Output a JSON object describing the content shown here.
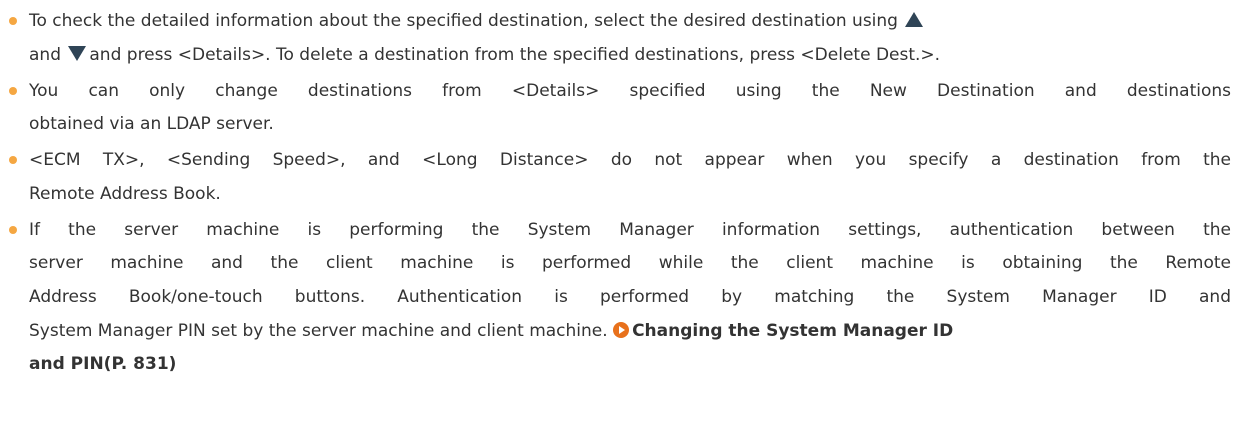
{
  "colors": {
    "text": "#333333",
    "bullet": "#f5a742",
    "arrow_icon": "#2f4456",
    "link_icon": "#e8711c"
  },
  "notes": [
    {
      "lines": [
        [
          "To check the detailed information about the specified destination, select the desired destination using"
        ],
        [
          "and",
          "and press <Details>. To delete a destination from the specified destinations, press <Delete Dest.>."
        ]
      ]
    },
    {
      "lines": [
        "You can only change destinations from <Details> specified using the New Destination and destinations",
        "obtained via an LDAP server."
      ]
    },
    {
      "lines": [
        "<ECM TX>, <Sending Speed>, and <Long Distance> do not appear when you specify a destination from the",
        "Remote Address Book."
      ]
    },
    {
      "lines": [
        "If the server machine is performing the System Manager information settings, authentication between the",
        "server machine and the client machine is performed while the client machine is obtaining the Remote",
        "Address Book/one-touch buttons. Authentication is performed by matching the System Manager ID and",
        "System Manager PIN set by the server machine and client machine."
      ],
      "link_line1": "Changing the System Manager ID",
      "link_line2": "and PIN(P. 831)"
    }
  ]
}
